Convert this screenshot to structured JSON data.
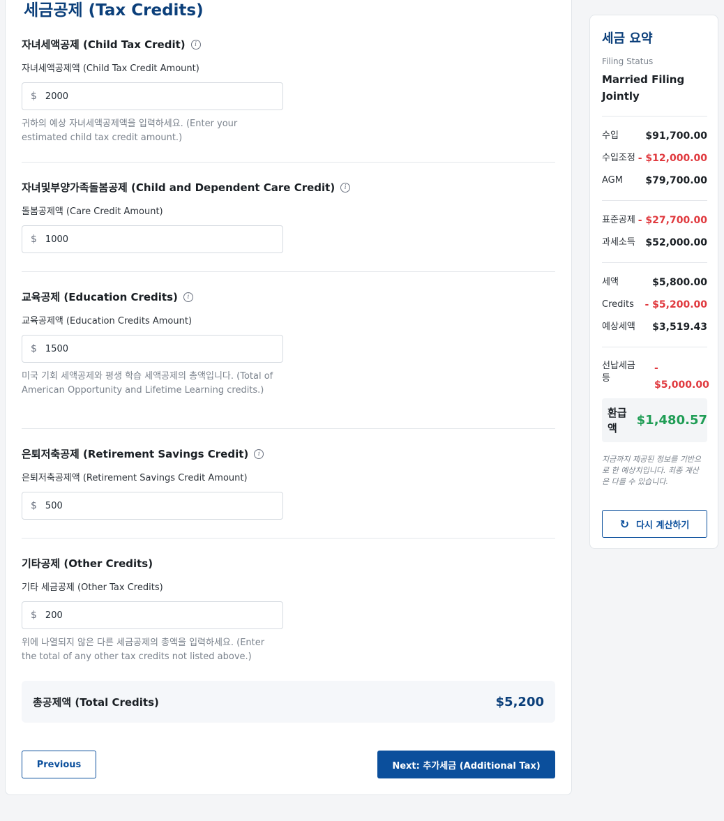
{
  "page": {
    "title": "세금공제 (Tax Credits)"
  },
  "sections": [
    {
      "title": "자녀세액공제 (Child Tax Credit)",
      "label": "자녀세액공제액 (Child Tax Credit Amount)",
      "value": "2000",
      "help": "귀하의 예상 자녀세액공제액을 입력하세요. (Enter your estimated child tax credit amount.)"
    },
    {
      "title": "자녀및부양가족돌봄공제 (Child and Dependent Care Credit)",
      "label": "돌봄공제액 (Care Credit Amount)",
      "value": "1000",
      "help": ""
    },
    {
      "title": "교육공제 (Education Credits)",
      "label": "교육공제액 (Education Credits Amount)",
      "value": "1500",
      "help": "미국 기회 세액공제와 평생 학습 세액공제의 총액입니다. (Total of American Opportunity and Lifetime Learning credits.)"
    },
    {
      "title": "은퇴저축공제 (Retirement Savings Credit)",
      "label": "은퇴저축공제액 (Retirement Savings Credit Amount)",
      "value": "500",
      "help": ""
    },
    {
      "title": "기타공제 (Other Credits)",
      "label": "기타 세금공제 (Other Tax Credits)",
      "value": "200",
      "help": "위에 나열되지 않은 다른 세금공제의 총액을 입력하세요. (Enter the total of any other tax credits not listed above.)"
    }
  ],
  "currency_symbol": "$",
  "total": {
    "label": "총공제액 (Total Credits)",
    "value": "$5,200"
  },
  "buttons": {
    "previous": "Previous",
    "next": "Next: 추가세금 (Additional Tax)"
  },
  "summary": {
    "title": "세금 요약",
    "filing_status_label": "Filing Status",
    "filing_status_value": "Married Filing Jointly",
    "income": {
      "label": "수입",
      "value": "$91,700.00"
    },
    "adjustments": {
      "label": "수입조정",
      "value": "- $12,000.00"
    },
    "agi": {
      "label": "AGM",
      "value": "$79,700.00"
    },
    "standard_deduction": {
      "label": "표준공제",
      "value": "- $27,700.00"
    },
    "taxable_income": {
      "label": "과세소득",
      "value": "$52,000.00"
    },
    "tax": {
      "label": "세액",
      "value": "$5,800.00"
    },
    "credits": {
      "label": "Credits",
      "value": "- $5,200.00"
    },
    "estimated_tax": {
      "label": "예상세액",
      "value": "$3,519.43"
    },
    "prepaid": {
      "label": "선납세금 등",
      "value": "- $5,000.00"
    },
    "refund": {
      "label": "환급액",
      "value": "$1,480.57"
    },
    "disclaimer": "지금까지 제공된 정보를 기반으로 한 예상치입니다. 최종 계산은 다를 수 있습니다.",
    "recalc_button": "다시 계산하기"
  },
  "colors": {
    "primary": "#0b4f9c",
    "negative": "#e0393e",
    "positive": "#1f9d55"
  }
}
